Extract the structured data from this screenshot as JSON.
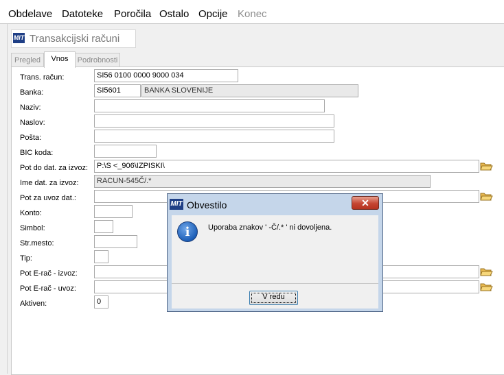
{
  "menu": {
    "items": [
      "Obdelave",
      "Datoteke",
      "Poročila",
      "Ostalo",
      "Opcije",
      "Konec"
    ]
  },
  "window": {
    "logo_text": "MIT",
    "title": "Transakcijski računi"
  },
  "tabs": [
    "Pregled",
    "Vnos",
    "Podrobnosti"
  ],
  "active_tab": "Vnos",
  "form": {
    "labels": {
      "trans_racun": "Trans. račun:",
      "banka": "Banka:",
      "naziv": "Naziv:",
      "naslov": "Naslov:",
      "posta": "Pošta:",
      "bic": "BIC koda:",
      "pot_izvoz": "Pot do dat. za izvoz:",
      "ime_izvoz": "Ime dat. za izvoz:",
      "pot_uvoz": "Pot za uvoz dat.:",
      "konto": "Konto:",
      "simbol": "Simbol:",
      "strmesto": "Str.mesto:",
      "tip": "Tip:",
      "erac_izvoz": "Pot E-rač - izvoz:",
      "erac_uvoz": "Pot E-rač - uvoz:",
      "aktiven": "Aktiven:"
    },
    "values": {
      "trans_racun": "SI56 0100 0000 9000 034",
      "banka_code": "SI5601",
      "banka_name": "BANKA SLOVENIJE",
      "naziv": "",
      "naslov": "",
      "posta": "",
      "bic": "",
      "pot_izvoz": "P:\\S            <_906\\IZPISKI\\",
      "ime_izvoz": "RACUN-545Č/.*",
      "pot_uvoz": "",
      "konto": "",
      "simbol": "",
      "strmesto": "",
      "tip": "",
      "erac_izvoz": "",
      "erac_uvoz": "",
      "aktiven": "0"
    }
  },
  "dialog": {
    "logo_text": "MIT",
    "title": "Obvestilo",
    "close_glyph": "✕",
    "info_glyph": "i",
    "message": "Uporaba znakov ' -Č/.* ' ni dovoljena.",
    "ok_label": "V redu"
  },
  "colors": {
    "logo_bg": "#1f3f86",
    "dialog_frame": "#c5d6ea",
    "close_red": "#c54532"
  },
  "icons": [
    "info-icon",
    "folder-icon",
    "close-icon",
    "app-logo-icon"
  ]
}
